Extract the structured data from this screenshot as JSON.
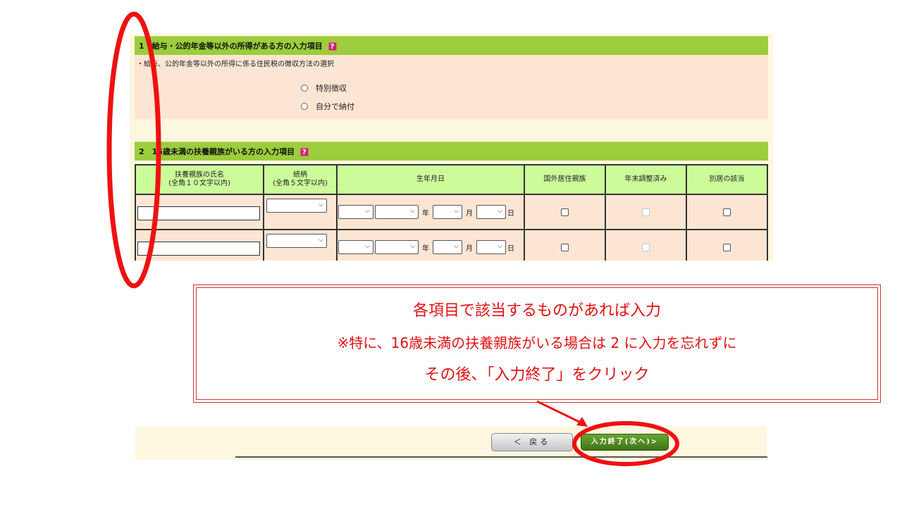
{
  "section1": {
    "header": "1　給与・公的年金等以外の所得がある方の入力項目",
    "help_icon": "?",
    "question": "・給与、公的年金等以外の所得に係る住民税の徴収方法の選択",
    "options": [
      "特別徴収",
      "自分で納付"
    ]
  },
  "section2": {
    "header": "2　16歳未満の扶養親族がいる方の入力項目",
    "help_icon": "?",
    "columns": {
      "name": "扶養親族の氏名",
      "name_note": "(全角１０文字以内)",
      "relation": "続柄",
      "relation_note": "(全角５文字以内)",
      "birthdate": "生年月日",
      "overseas": "国外居住親族",
      "year_end": "年末調整済み",
      "separate": "別居の該当"
    },
    "date_labels": {
      "year": "年",
      "month": "月",
      "day": "日"
    }
  },
  "callout": {
    "line1": "各項目で該当するものがあれば入力",
    "line2": "※特に、16歳未満の扶養親族がいる場合は 2 に入力を忘れずに",
    "line3": "その後、「入力終了」をクリック"
  },
  "footer": {
    "back_label": "＜ 戻る",
    "next_label": "入力終了(次へ)>"
  },
  "colors": {
    "section_header": "#9ccd3c",
    "table_header": "#ccfb9a",
    "body_bg": "#fde5d3",
    "panel_bg": "#fdf7df",
    "annotation_red": "#e01010"
  }
}
